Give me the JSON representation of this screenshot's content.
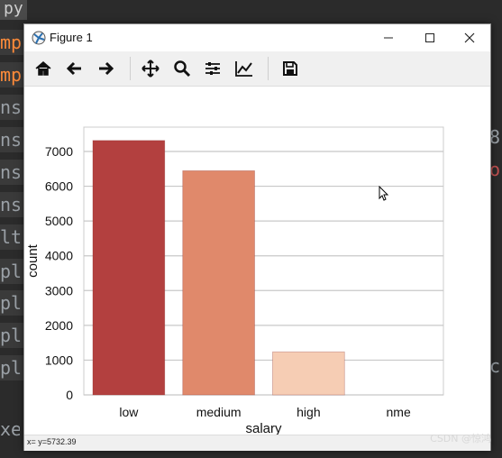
{
  "window": {
    "title": "Figure 1",
    "minimize_glyph": "—",
    "maximize_glyph": "☐",
    "close_glyph": "✕"
  },
  "toolbar": {
    "buttons": [
      "home-icon",
      "back-arrow-icon",
      "forward-arrow-icon",
      "pan-icon",
      "zoom-icon",
      "configure-subplots-icon",
      "edit-axis-icon",
      "save-icon"
    ]
  },
  "status": {
    "coords": "x= y=5732.39"
  },
  "watermark": "CSDN @惊鸿",
  "editor": {
    "top_fragment": "py",
    "left_fragments": [
      "mp",
      "mp",
      "ns",
      "ns",
      "ns",
      "ns",
      "lt",
      "pl",
      "pl",
      "pl",
      "pl"
    ],
    "bottom_fragment": "xe",
    "right_fragments": [
      "8",
      "o",
      "c"
    ]
  },
  "chart_data": {
    "type": "bar",
    "categories": [
      "low",
      "medium",
      "high",
      "nme"
    ],
    "values": [
      7316,
      6446,
      1237,
      0
    ],
    "colors": [
      "#b3403f",
      "#e0896b",
      "#f6cdb4",
      "#f8e4d8"
    ],
    "xlabel": "salary",
    "ylabel": "count",
    "yticks": [
      0,
      1000,
      2000,
      3000,
      4000,
      5000,
      6000,
      7000
    ],
    "ylim": [
      0,
      7700
    ],
    "grid": true
  }
}
